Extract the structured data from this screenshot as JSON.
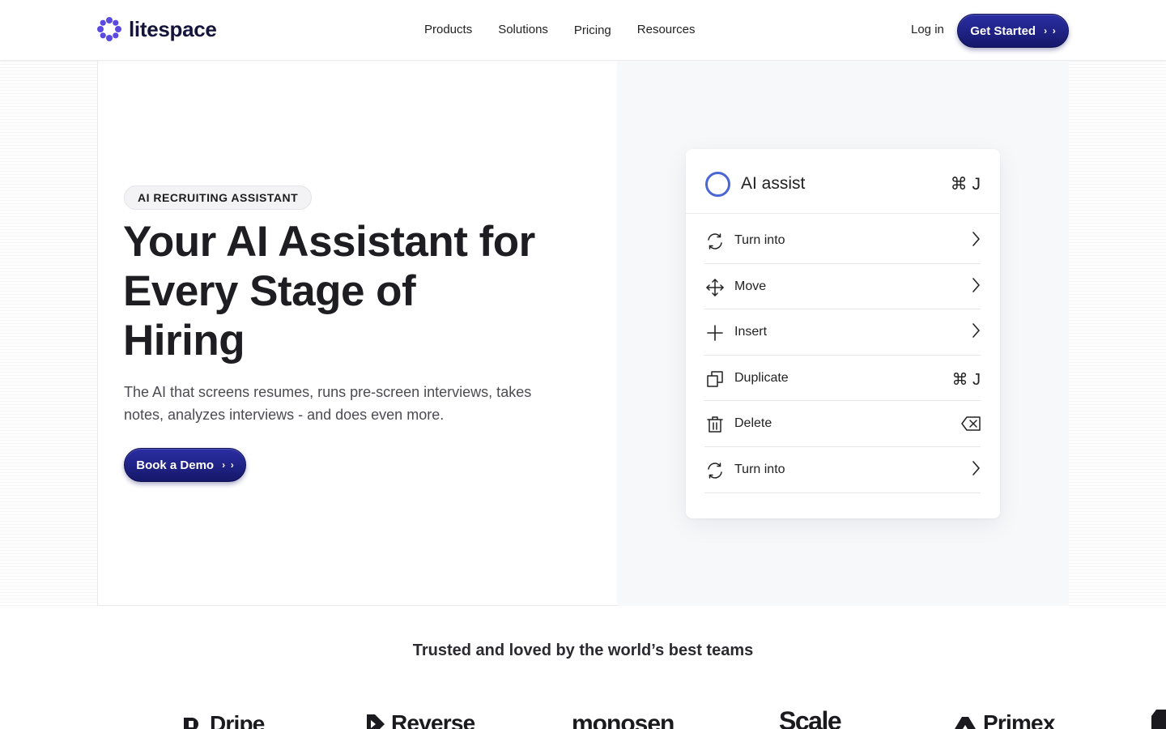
{
  "header": {
    "brand": "litespace",
    "nav": [
      "Products",
      "Solutions",
      "Pricing",
      "Resources"
    ],
    "login": "Log in",
    "cta": "Get Started"
  },
  "hero": {
    "badge": "AI RECRUITING ASSISTANT",
    "title": "Your AI Assistant for Every Stage of Hiring",
    "subtitle": "The AI that screens resumes, runs pre-screen interviews, takes notes, analyzes interviews - and does even more.",
    "cta": "Book a Demo"
  },
  "card": {
    "title": "AI assist",
    "shortcut": "⌘ J",
    "items": [
      {
        "label": "Turn into",
        "icon": "refresh-icon",
        "right": "chevron"
      },
      {
        "label": "Move",
        "icon": "move-icon",
        "right": "chevron"
      },
      {
        "label": "Insert",
        "icon": "plus-icon",
        "right": "chevron"
      },
      {
        "label": "Duplicate",
        "icon": "duplicate-icon",
        "right": "⌘ J"
      },
      {
        "label": "Delete",
        "icon": "trash-icon",
        "right": "backspace"
      },
      {
        "label": "Turn into",
        "icon": "refresh-icon",
        "right": "chevron"
      }
    ]
  },
  "trusted": {
    "heading": "Trusted and loved by the world’s best teams",
    "logos": [
      "Dripe",
      "Reverse",
      "monosen",
      "Scale",
      "Primex"
    ]
  },
  "colors": {
    "accent": "#2a2ea3",
    "accent_dark": "#16186a",
    "ring": "#4a66d6",
    "logo_dots": "#5b4ae0"
  }
}
